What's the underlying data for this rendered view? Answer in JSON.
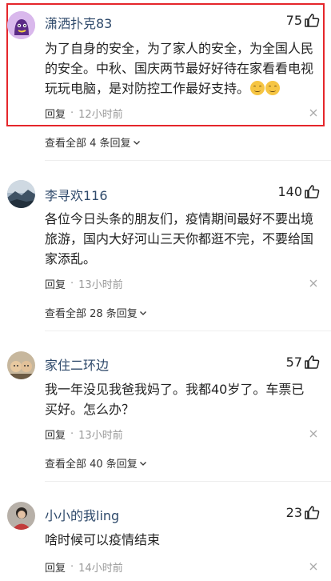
{
  "comments": [
    {
      "username": "潇洒扑克83",
      "likes": "75",
      "text": "为了自身的安全，为了家人的安全，为全国人民的安全。中秋、国庆两节最好好待在家看看电视玩玩电脑，是对防控工作最好支持。",
      "reply_label": "回复",
      "dot": "·",
      "time": "12小时前",
      "view_all": "查看全部 4 条回复"
    },
    {
      "username": "李寻欢116",
      "likes": "140",
      "text": "各位今日头条的朋友们，疫情期间最好不要出境旅游，国内大好河山三天你都逛不完，不要给国家添乱。",
      "reply_label": "回复",
      "dot": "·",
      "time": "13小时前",
      "view_all": "查看全部 28 条回复"
    },
    {
      "username": "家住二环边",
      "likes": "57",
      "text": "我一年没见我爸我妈了。我都40岁了。车票已买好。怎么办？",
      "reply_label": "回复",
      "dot": "·",
      "time": "13小时前",
      "view_all": "查看全部 40 条回复"
    },
    {
      "username": "小小的我ling",
      "likes": "23",
      "text": "啥时候可以疫情结束",
      "reply_label": "回复",
      "dot": "·",
      "time": "14小时前"
    }
  ],
  "colors": {
    "username": "#2f4a6b",
    "highlight": "#e5262b",
    "time": "#999999"
  },
  "icons": {
    "like": "thumbs-up-icon",
    "close": "close-icon",
    "expand": "chevron-down-icon",
    "emoji": "smile-emoji-icon"
  }
}
